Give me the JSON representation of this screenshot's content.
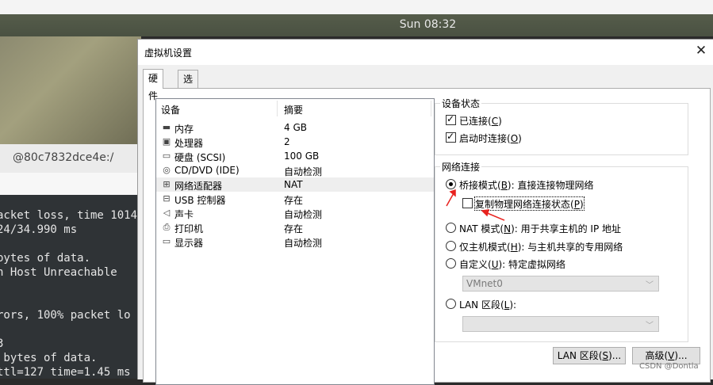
{
  "desktop": {
    "clock": "Sun 08:32",
    "terminal_title": "@80c7832dce4e:/",
    "terminal_lines": [
      "acket loss, time 1014",
      "24/34.990 ms",
      "",
      "bytes of data.",
      "n Host Unreachable",
      "",
      "",
      "rors, 100% packet lo",
      "",
      "3",
      " bytes of data.",
      "ttl=127 time=1.45 ms"
    ]
  },
  "dialog": {
    "title": "虚拟机设置",
    "tabs": [
      "硬件",
      "选项"
    ],
    "device_list": {
      "col_device": "设备",
      "col_summary": "摘要",
      "rows": [
        {
          "name": "内存",
          "summary": "4 GB",
          "icon": "memory-icon",
          "glyph": "▬"
        },
        {
          "name": "处理器",
          "summary": "2",
          "icon": "cpu-icon",
          "glyph": "▣"
        },
        {
          "name": "硬盘 (SCSI)",
          "summary": "100 GB",
          "icon": "hard-disk-icon",
          "glyph": "▭"
        },
        {
          "name": "CD/DVD (IDE)",
          "summary": "自动检测",
          "icon": "cd-dvd-icon",
          "glyph": "◎"
        },
        {
          "name": "网络适配器",
          "summary": "NAT",
          "icon": "network-adapter-icon",
          "glyph": "⊞"
        },
        {
          "name": "USB 控制器",
          "summary": "存在",
          "icon": "usb-icon",
          "glyph": "⊟"
        },
        {
          "name": "声卡",
          "summary": "自动检测",
          "icon": "sound-card-icon",
          "glyph": "◁"
        },
        {
          "name": "打印机",
          "summary": "存在",
          "icon": "printer-icon",
          "glyph": "⎙"
        },
        {
          "name": "显示器",
          "summary": "自动检测",
          "icon": "display-icon",
          "glyph": "▭"
        }
      ]
    },
    "device_status": {
      "legend": "设备状态",
      "connected": {
        "prefix": "已连接(",
        "key": "C",
        "suffix": ")",
        "checked": true
      },
      "connect_on_power": {
        "prefix": "启动时连接(",
        "key": "O",
        "suffix": ")",
        "checked": true
      }
    },
    "network": {
      "legend": "网络连接",
      "bridged": {
        "prefix": "桥接模式(",
        "key": "B",
        "suffix": "): 直接连接物理网络",
        "selected": true
      },
      "replicate": {
        "prefix": "复制物理网络连接状态(",
        "key": "P",
        "suffix": ")",
        "checked": false
      },
      "nat": {
        "prefix": "NAT 模式(",
        "key": "N",
        "suffix": "): 用于共享主机的 IP 地址",
        "selected": false
      },
      "host_only": {
        "prefix": "仅主机模式(",
        "key": "H",
        "suffix": "): 与主机共享的专用网络",
        "selected": false
      },
      "custom": {
        "prefix": "自定义(",
        "key": "U",
        "suffix": "): 特定虚拟网络",
        "selected": false
      },
      "custom_value": "VMnet0",
      "lan": {
        "prefix": "LAN 区段(",
        "key": "L",
        "suffix": "):",
        "selected": false
      },
      "lan_value": ""
    },
    "buttons": {
      "lan_segments": {
        "prefix": "LAN 区段(",
        "key": "S",
        "suffix": ")..."
      },
      "advanced": {
        "prefix": "高级(",
        "key": "V",
        "suffix": ")..."
      }
    }
  },
  "watermark": "CSDN @Dontla",
  "colors": {
    "annotation_arrow": "#e8231f"
  }
}
